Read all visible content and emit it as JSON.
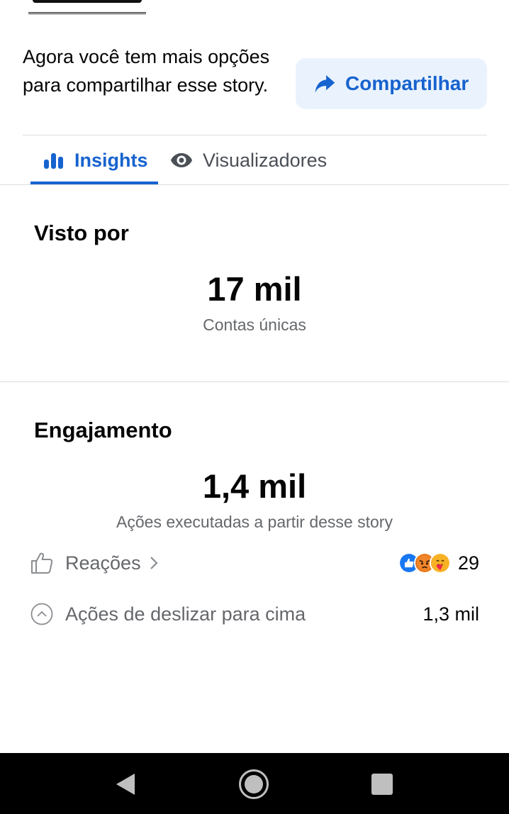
{
  "share_banner": {
    "message": "Agora você tem mais opções para compartilhar esse story.",
    "button_label": "Compartilhar"
  },
  "tabs": [
    {
      "label": "Insights",
      "active": true
    },
    {
      "label": "Visualizadores",
      "active": false
    }
  ],
  "seen_by": {
    "title": "Visto por",
    "value": "17 mil",
    "caption": "Contas únicas"
  },
  "engagement": {
    "title": "Engajamento",
    "value": "1,4 mil",
    "caption": "Ações executadas a partir desse story",
    "rows": [
      {
        "label": "Reações",
        "value": "29",
        "icons": [
          "like-icon",
          "angry-icon",
          "care-icon"
        ]
      },
      {
        "label": "Ações de deslizar para cima",
        "value": "1,3 mil",
        "icon": "chevron-up-circle-icon"
      }
    ]
  },
  "colors": {
    "accent": "#1763cf",
    "share_bg": "#eaf3fd",
    "text_secondary": "#65676b"
  }
}
